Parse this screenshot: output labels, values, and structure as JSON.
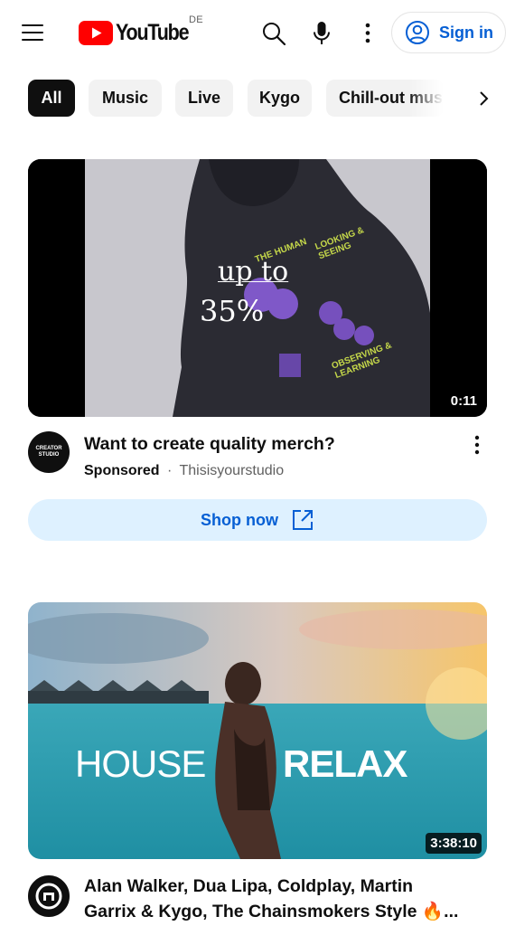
{
  "header": {
    "logo_text": "YouTube",
    "country_code": "DE",
    "signin_label": "Sign in",
    "brand_red": "#ff0000",
    "link_blue": "#065fd4",
    "icons": [
      "menu-icon",
      "search-icon",
      "mic-icon",
      "more-vert-icon",
      "account-circle-icon"
    ]
  },
  "chips": {
    "items": [
      {
        "label": "All",
        "selected": true
      },
      {
        "label": "Music",
        "selected": false
      },
      {
        "label": "Live",
        "selected": false
      },
      {
        "label": "Kygo",
        "selected": false
      },
      {
        "label": "Chill-out mus",
        "selected": false
      }
    ],
    "next_icon": "chevron-right-icon"
  },
  "ad": {
    "thumbnail_overlay_line1": "up to",
    "thumbnail_overlay_line2": "35%",
    "hoodie_text_1": "LOOKING & SEEING",
    "hoodie_text_2": "OBSERVING & LEARNING",
    "hoodie_text_3": "THE HUMAN",
    "duration": "0:11",
    "avatar_text": "CREATOR STUDIO",
    "title": "Want to create quality merch?",
    "sponsored_label": "Sponsored",
    "separator": "·",
    "advertiser": "Thisisyourstudio",
    "cta_label": "Shop now"
  },
  "video": {
    "thumbnail_text_left": "HOUSE",
    "thumbnail_text_right": "RELAX",
    "duration": "3:38:10",
    "title_line1": "Alan Walker, Dua Lipa, Coldplay, Martin",
    "title_line2": "Garrix & Kygo, The Chainsmokers Style 🔥..."
  }
}
